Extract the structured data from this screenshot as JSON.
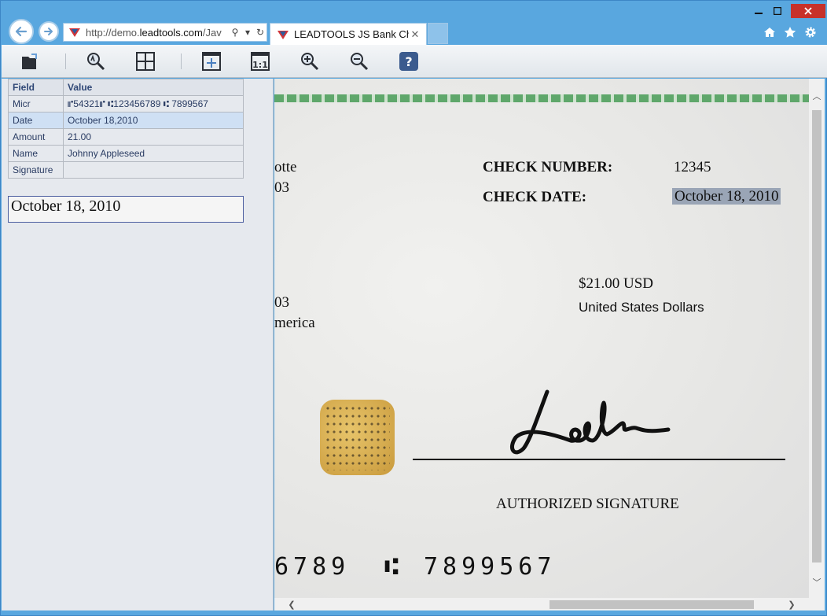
{
  "browser": {
    "address_url_prefix": "http://demo.",
    "address_url_domain": "leadtools.com",
    "address_url_suffix": "/Jav",
    "tab_title": "LEADTOOLS JS Bank Ch...",
    "tab_close": "✕"
  },
  "fields_table": {
    "header_field": "Field",
    "header_value": "Value",
    "rows": [
      {
        "field": "Micr",
        "value": "⑈54321⑈ ⑆123456789 ⑆ 7899567"
      },
      {
        "field": "Date",
        "value": "October 18,2010"
      },
      {
        "field": "Amount",
        "value": "21.00"
      },
      {
        "field": "Name",
        "value": "Johnny Appleseed"
      },
      {
        "field": "Signature",
        "value": ""
      }
    ],
    "selected_row": 1
  },
  "preview_text": "October 18, 2010",
  "check": {
    "partial_left_1": "otte",
    "partial_left_2": "03",
    "partial_left_3": "03",
    "partial_left_4": "merica",
    "check_number_label": "CHECK NUMBER:",
    "check_number": "12345",
    "check_date_label": "CHECK DATE:",
    "check_date": "October 18, 2010",
    "amount": "$21.00 USD",
    "currency": "United States Dollars",
    "authorized": "AUTHORIZED SIGNATURE",
    "micr_line_1": "6789",
    "micr_sym": "⑆",
    "micr_line_2": "7899567"
  },
  "icons": {
    "accent": "#59a7df",
    "highlight": "#9aa5b6"
  }
}
